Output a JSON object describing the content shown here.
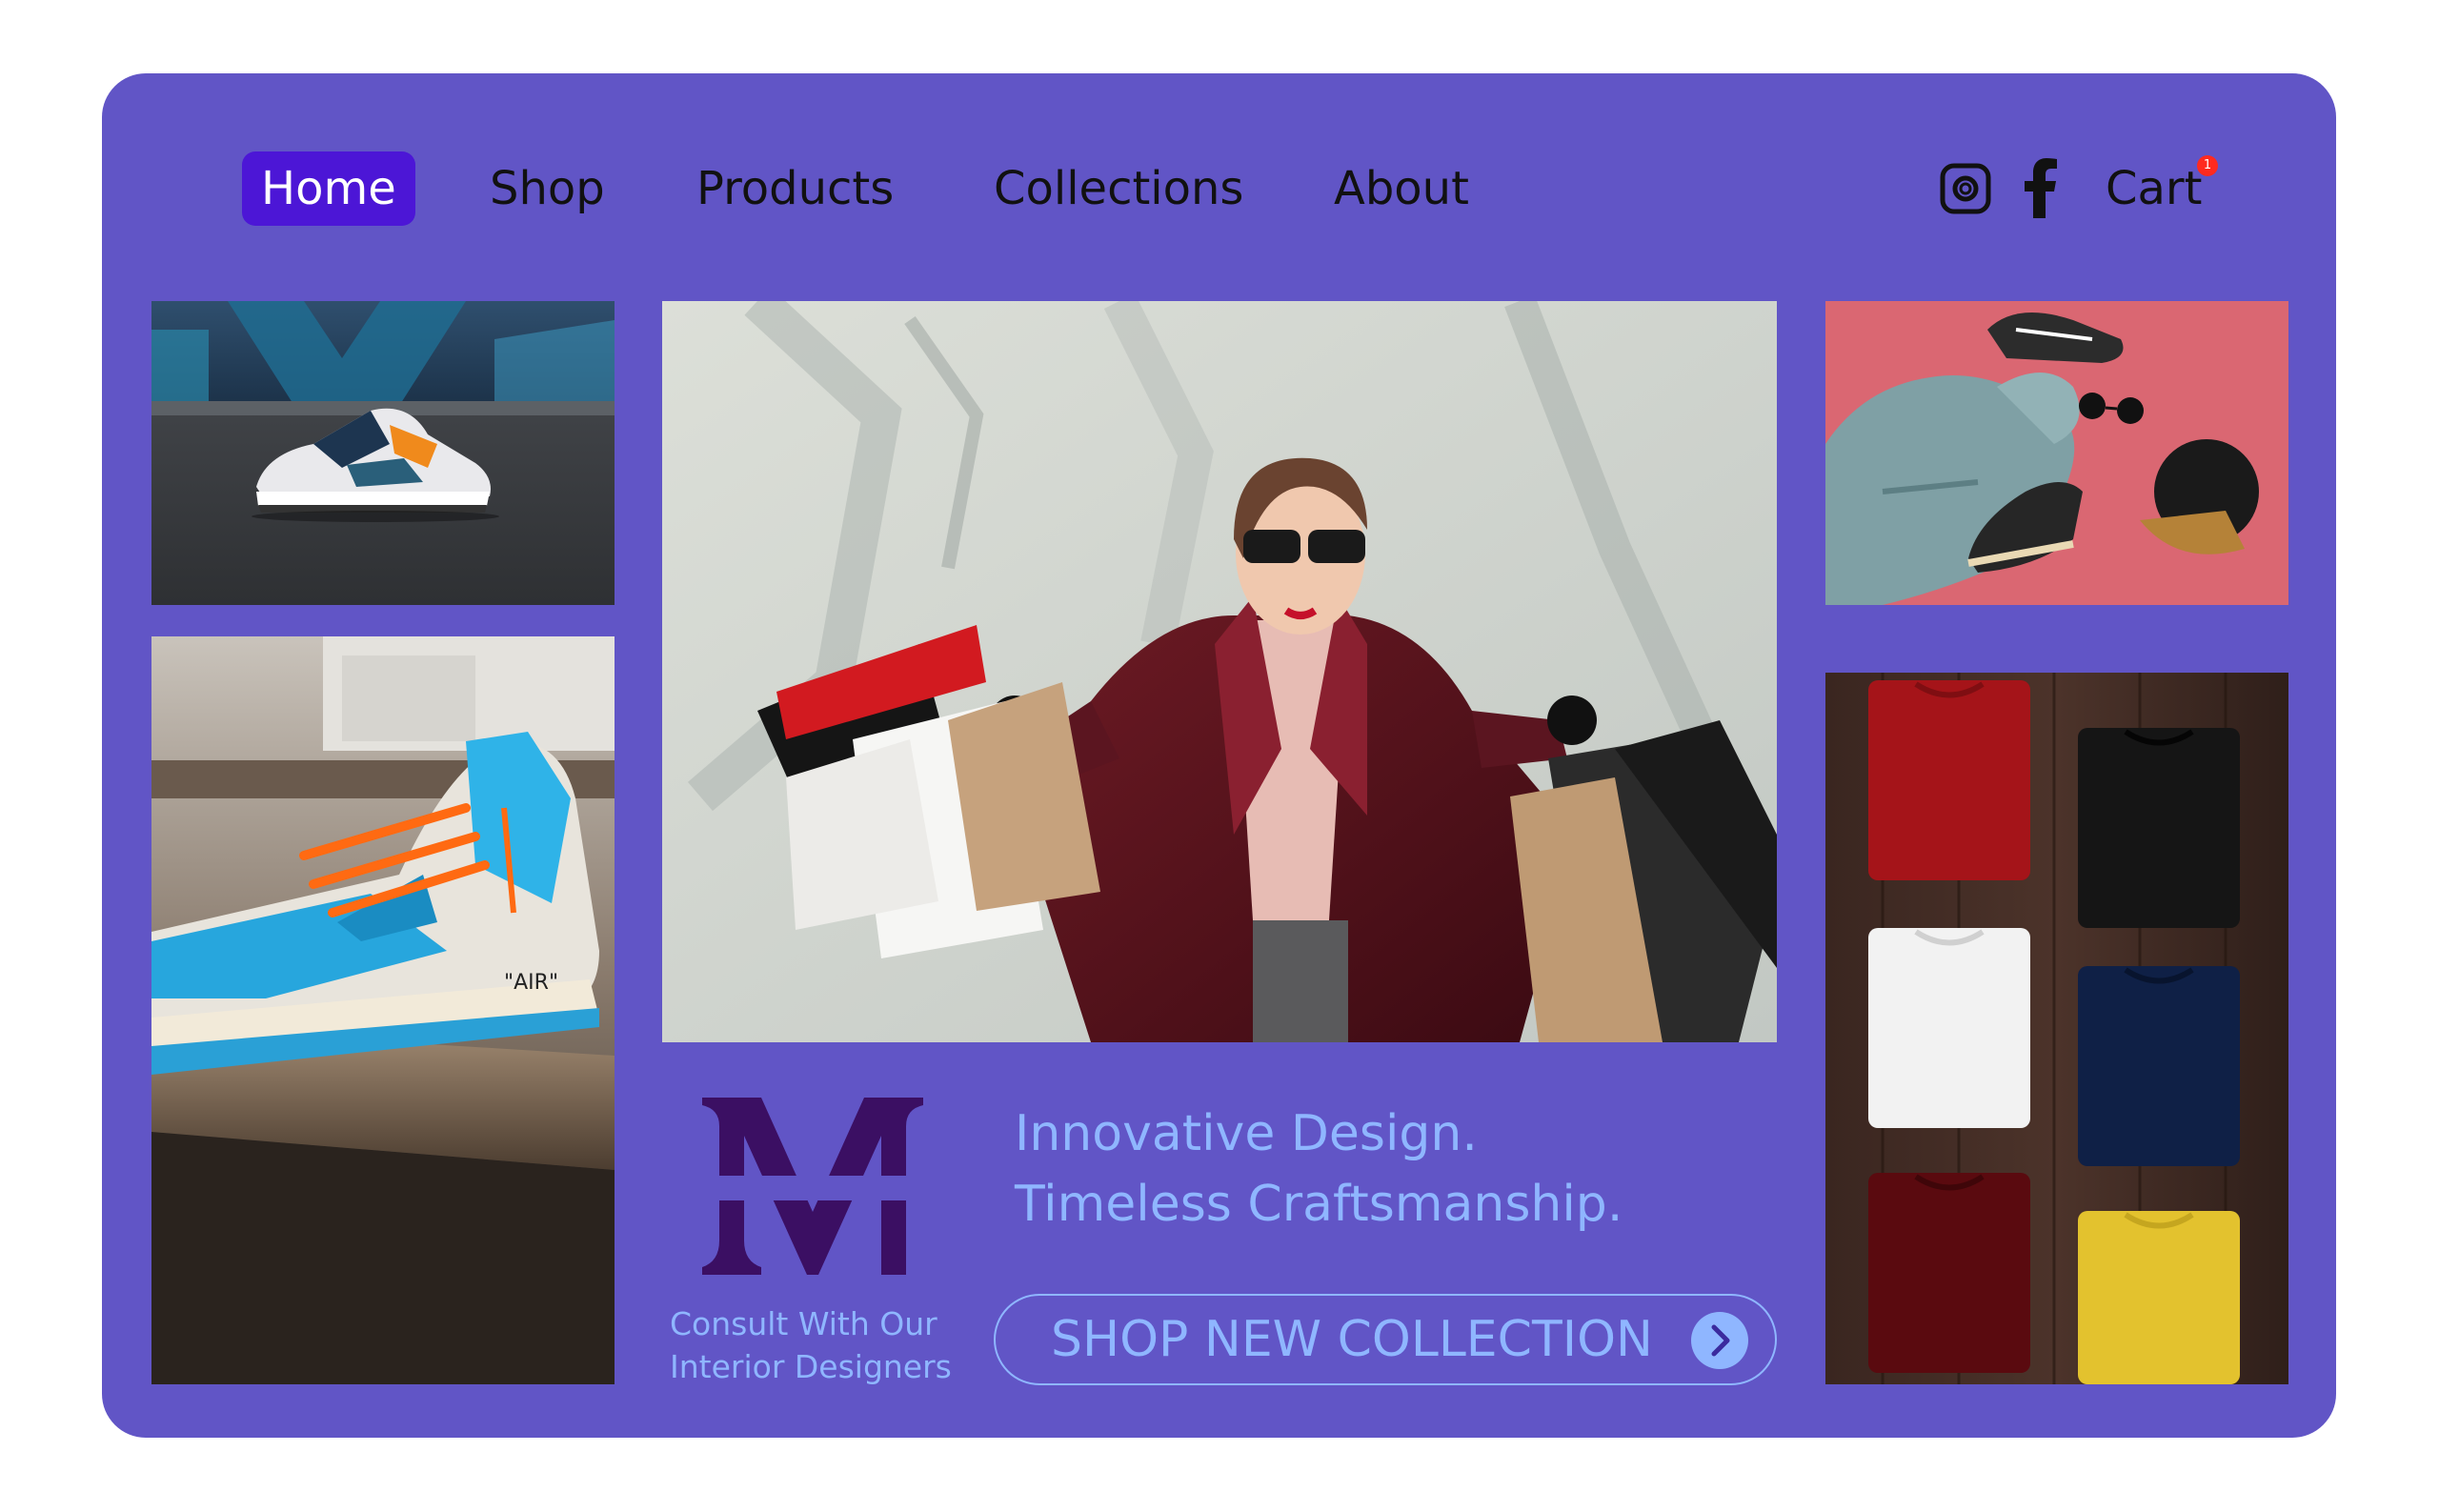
{
  "nav": {
    "items": [
      {
        "label": "Home",
        "active": true
      },
      {
        "label": "Shop"
      },
      {
        "label": "Products"
      },
      {
        "label": "Collections"
      },
      {
        "label": "About"
      }
    ],
    "cart_label": "Cart",
    "cart_count": "1",
    "social_icons": [
      "instagram-icon",
      "facebook-icon"
    ]
  },
  "images": {
    "sneaker_street": "sneaker-street-photo",
    "sneaker_air": "sneaker-air-photo",
    "shopping": "woman-with-shopping-bags-photo",
    "flatlay": "clothing-flatlay-photo",
    "tshirts": "folded-tshirts-photo"
  },
  "brand": {
    "logo_letter": "M",
    "consult_line1": "Consult With Our",
    "consult_line2": "Interior Designers"
  },
  "hero": {
    "tagline_line1": "Innovative Design.",
    "tagline_line2": "Timeless Craftsmanship.",
    "cta_label": "SHOP NEW COLLECTION"
  },
  "colors": {
    "frame_bg": "#6155c6",
    "active_nav": "#4c16d6",
    "accent_text": "#8fb6ff",
    "logo": "#3b0f63",
    "badge": "#ff2a1f"
  }
}
